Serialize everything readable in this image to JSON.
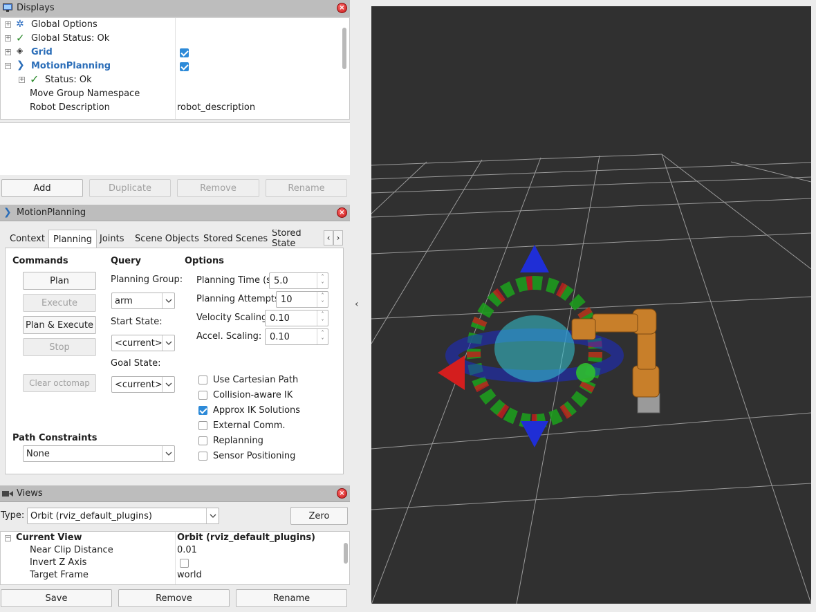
{
  "displays_panel": {
    "title": "Displays",
    "items": [
      {
        "label": "Global Options",
        "value": ""
      },
      {
        "label": "Global Status: Ok",
        "value": ""
      },
      {
        "label": "Grid",
        "value": "",
        "checked": true
      },
      {
        "label": "MotionPlanning",
        "value": "",
        "checked": true
      },
      {
        "label": "Status: Ok",
        "value": ""
      },
      {
        "label": "Move Group Namespace",
        "value": ""
      },
      {
        "label": "Robot Description",
        "value": "robot_description"
      }
    ],
    "buttons": {
      "add": "Add",
      "duplicate": "Duplicate",
      "remove": "Remove",
      "rename": "Rename"
    }
  },
  "motion_panel": {
    "title": "MotionPlanning",
    "tabs": [
      "Context",
      "Planning",
      "Joints",
      "Scene Objects",
      "Stored Scenes",
      "Stored State"
    ],
    "active_tab": "Planning",
    "commands": {
      "heading": "Commands",
      "plan": "Plan",
      "execute": "Execute",
      "plan_execute": "Plan & Execute",
      "stop": "Stop",
      "clear_octomap": "Clear octomap"
    },
    "query": {
      "heading": "Query",
      "planning_group_label": "Planning Group:",
      "planning_group_value": "arm",
      "start_state_label": "Start State:",
      "start_state_value": "<current>",
      "goal_state_label": "Goal State:",
      "goal_state_value": "<current>"
    },
    "options": {
      "heading": "Options",
      "planning_time_label": "Planning Time (s):",
      "planning_time_value": "5.0",
      "planning_attempts_label": "Planning Attempts:",
      "planning_attempts_value": "10",
      "velocity_label": "Velocity Scaling:",
      "velocity_value": "0.10",
      "accel_label": "Accel. Scaling:",
      "accel_value": "0.10",
      "checks": [
        {
          "label": "Use Cartesian Path",
          "checked": false
        },
        {
          "label": "Collision-aware IK",
          "checked": false
        },
        {
          "label": "Approx IK Solutions",
          "checked": true
        },
        {
          "label": "External Comm.",
          "checked": false
        },
        {
          "label": "Replanning",
          "checked": false
        },
        {
          "label": "Sensor Positioning",
          "checked": false
        }
      ]
    },
    "path_constraints": {
      "heading": "Path Constraints",
      "value": "None"
    }
  },
  "views_panel": {
    "title": "Views",
    "type_label": "Type:",
    "type_value": "Orbit (rviz_default_plugins)",
    "zero": "Zero",
    "current_view": "Current View",
    "current_view_value": "Orbit (rviz_default_plugins)",
    "props": [
      {
        "label": "Near Clip Distance",
        "value": "0.01"
      },
      {
        "label": "Invert Z Axis",
        "value": ""
      },
      {
        "label": "Target Frame",
        "value": "world"
      }
    ],
    "buttons": {
      "save": "Save",
      "remove": "Remove",
      "rename": "Rename"
    }
  },
  "viewport": {
    "background": "#303030",
    "grid_color": "#a0a0a0",
    "robot_color": "#c87f2a"
  }
}
